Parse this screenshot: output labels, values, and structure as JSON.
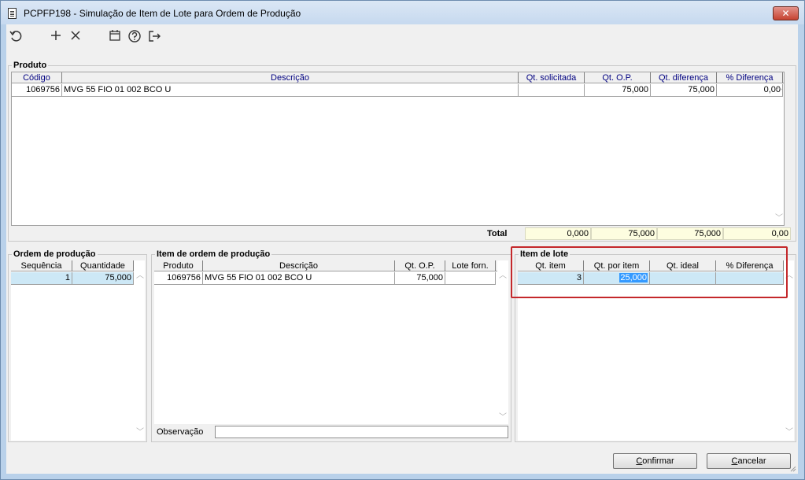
{
  "window": {
    "title": "PCPFP198 - Simulação de Item de Lote para Ordem de Produção",
    "close_label": "✕"
  },
  "toolbar": {
    "icons": [
      "undo-icon",
      "add-icon",
      "delete-icon",
      "calendar-icon",
      "help-icon",
      "exit-icon"
    ]
  },
  "produto": {
    "title": "Produto",
    "columns": [
      "Código",
      "Descrição",
      "Qt. solicitada",
      "Qt. O.P.",
      "Qt. diferença",
      "% Diferença"
    ],
    "rows": [
      {
        "codigo": "1069756",
        "descricao": "MVG 55 FIO 01 002 BCO U",
        "qt_solicitada": "",
        "qt_op": "75,000",
        "qt_diferenca": "75,000",
        "pct_diferenca": "0,00"
      }
    ],
    "total_label": "Total",
    "totals": [
      "0,000",
      "75,000",
      "75,000",
      "0,00"
    ]
  },
  "ordem": {
    "title": "Ordem de produção",
    "columns": [
      "Sequência",
      "Quantidade"
    ],
    "rows": [
      {
        "sequencia": "1",
        "quantidade": "75,000"
      }
    ]
  },
  "item_ordem": {
    "title": "Item de ordem de produção",
    "columns": [
      "Produto",
      "Descrição",
      "Qt. O.P.",
      "Lote forn."
    ],
    "rows": [
      {
        "produto": "1069756",
        "descricao": "MVG 55 FIO 01 002 BCO U",
        "qt_op": "75,000",
        "lote_forn": ""
      }
    ],
    "observacao_label": "Observação",
    "observacao_value": ""
  },
  "item_lote": {
    "title": "Item de lote",
    "columns": [
      "Qt. item",
      "Qt. por item",
      "Qt. ideal",
      "% Diferença"
    ],
    "rows": [
      {
        "qt_item": "3",
        "qt_por_item": "25,000",
        "qt_ideal": "",
        "pct_diferenca": ""
      }
    ]
  },
  "buttons": {
    "confirm_first": "C",
    "confirm_rest": "onfirmar",
    "cancel_first": "C",
    "cancel_rest": "ancelar"
  },
  "colors": {
    "highlight_box": "#c4282b",
    "selected_row": "#cde8f6",
    "header_text": "#000080",
    "total_bg": "#fdfde0"
  }
}
